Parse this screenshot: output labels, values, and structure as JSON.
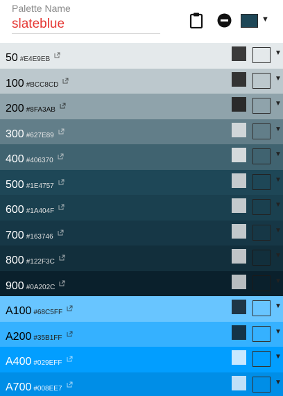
{
  "header": {
    "label": "Palette Name",
    "value": "slateblue",
    "swatch_color": "#1E4757",
    "icons": [
      "clipboard-icon",
      "minus-circle-icon",
      "chevron-down-icon"
    ]
  },
  "rows": [
    {
      "name": "50",
      "hex": "#E4E9EB",
      "bg": "#E4E9EB",
      "text": "#000000",
      "hex_color": "#333333",
      "swA": "#3a3a3a",
      "swB": "#E4E9EB",
      "swB_border": "#333333"
    },
    {
      "name": "100",
      "hex": "#BCC8CD",
      "bg": "#BCC8CD",
      "text": "#000000",
      "hex_color": "#222222",
      "swA": "#333333",
      "swB": "#BCC8CD",
      "swB_border": "#333333"
    },
    {
      "name": "200",
      "hex": "#8FA3AB",
      "bg": "#8FA3AB",
      "text": "#000000",
      "hex_color": "#111111",
      "swA": "#2a2a2a",
      "swB": "#8FA3AB",
      "swB_border": "#333333"
    },
    {
      "name": "300",
      "hex": "#627E89",
      "bg": "#627E89",
      "text": "#ffffff",
      "hex_color": "#e8e8e8",
      "swA": "#d0d6d9",
      "swB": "#627E89",
      "swB_border": "#333333"
    },
    {
      "name": "400",
      "hex": "#406370",
      "bg": "#406370",
      "text": "#ffffff",
      "hex_color": "#e0e0e0",
      "swA": "#d5dadc",
      "swB": "#406370",
      "swB_border": "#2a2a2a"
    },
    {
      "name": "500",
      "hex": "#1E4757",
      "bg": "#1E4757",
      "text": "#ffffff",
      "hex_color": "#dddddd",
      "swA": "#c5cbce",
      "swB": "#1E4757",
      "swB_border": "#222222"
    },
    {
      "name": "600",
      "hex": "#1A404F",
      "bg": "#1A404F",
      "text": "#ffffff",
      "hex_color": "#dddddd",
      "swA": "#c4cacd",
      "swB": "#1A404F",
      "swB_border": "#222222"
    },
    {
      "name": "700",
      "hex": "#163746",
      "bg": "#163746",
      "text": "#ffffff",
      "hex_color": "#dddddd",
      "swA": "#c2c8cb",
      "swB": "#163746",
      "swB_border": "#222222"
    },
    {
      "name": "800",
      "hex": "#122F3C",
      "bg": "#122F3C",
      "text": "#ffffff",
      "hex_color": "#dddddd",
      "swA": "#bfc4c7",
      "swB": "#122F3C",
      "swB_border": "#1a1a1a"
    },
    {
      "name": "900",
      "hex": "#0A202C",
      "bg": "#0A202C",
      "text": "#ffffff",
      "hex_color": "#dddddd",
      "swA": "#b8bdc0",
      "swB": "#0A202C",
      "swB_border": "#1a1a1a"
    },
    {
      "name": "A100",
      "hex": "#68C5FF",
      "bg": "#68C5FF",
      "text": "#000000",
      "hex_color": "#222222",
      "swA": "#1e3646",
      "swB": "#68C5FF",
      "swB_border": "#333333"
    },
    {
      "name": "A200",
      "hex": "#35B1FF",
      "bg": "#35B1FF",
      "text": "#000000",
      "hex_color": "#222222",
      "swA": "#143448",
      "swB": "#35B1FF",
      "swB_border": "#333333"
    },
    {
      "name": "A400",
      "hex": "#029EFF",
      "bg": "#029EFF",
      "text": "#ffffff",
      "hex_color": "#e8f4ff",
      "swA": "#c8e8ff",
      "swB": "#029EFF",
      "swB_border": "#333333"
    },
    {
      "name": "A700",
      "hex": "#008EE7",
      "bg": "#008EE7",
      "text": "#ffffff",
      "hex_color": "#e8f4ff",
      "swA": "#c0e0f8",
      "swB": "#008EE7",
      "swB_border": "#333333"
    }
  ]
}
